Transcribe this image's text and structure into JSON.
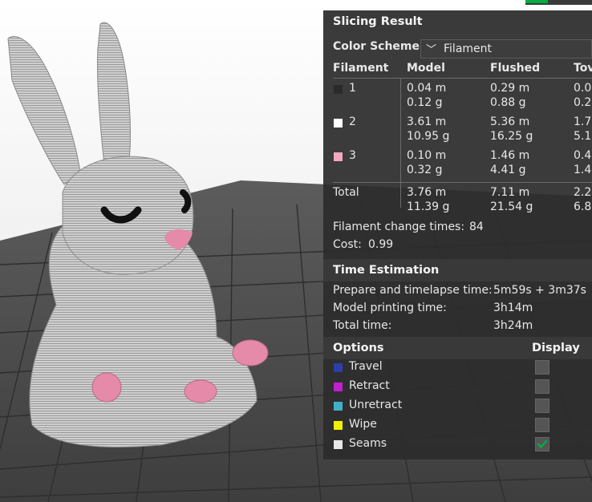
{
  "panel": {
    "title": "Slicing Result",
    "color_scheme_label": "Color Scheme",
    "color_scheme_value": "Filament",
    "table": {
      "headers": [
        "Filament",
        "Model",
        "Flushed",
        "Tov"
      ],
      "rows": [
        {
          "id": "1",
          "swatch": "#2a2a2a",
          "model_m": "0.04 m",
          "model_g": "0.12 g",
          "flushed_m": "0.29 m",
          "flushed_g": "0.88 g",
          "tower_m": "0.0",
          "tower_g": "0.2"
        },
        {
          "id": "2",
          "swatch": "#ffffff",
          "model_m": "3.61 m",
          "model_g": "10.95 g",
          "flushed_m": "5.36 m",
          "flushed_g": "16.25 g",
          "tower_m": "1.7",
          "tower_g": "5.1"
        },
        {
          "id": "3",
          "swatch": "#f4a8c0",
          "model_m": "0.10 m",
          "model_g": "0.32 g",
          "flushed_m": "1.46 m",
          "flushed_g": "4.41 g",
          "tower_m": "0.4",
          "tower_g": "1.4"
        }
      ],
      "total": {
        "label": "Total",
        "model_m": "3.76 m",
        "model_g": "11.39 g",
        "flushed_m": "7.11 m",
        "flushed_g": "21.54 g",
        "tower_m": "2.2",
        "tower_g": "6.8"
      }
    },
    "filament_change_label": "Filament change times:",
    "filament_change_value": "84",
    "cost_label": "Cost:",
    "cost_value": "0.99",
    "time_title": "Time Estimation",
    "prepare_label": "Prepare and timelapse time:",
    "prepare_value": "5m59s + 3m37s",
    "model_time_label": "Model printing time:",
    "model_time_value": "3h14m",
    "total_time_label": "Total time:",
    "total_time_value": "3h24m",
    "options_title": "Options",
    "display_title": "Display",
    "options": [
      {
        "label": "Travel",
        "color": "#2c3ea8",
        "checked": false
      },
      {
        "label": "Retract",
        "color": "#c020d0",
        "checked": false
      },
      {
        "label": "Unretract",
        "color": "#40b0c8",
        "checked": false
      },
      {
        "label": "Wipe",
        "color": "#f0f000",
        "checked": false
      },
      {
        "label": "Seams",
        "color": "#e8e8e8",
        "checked": true
      }
    ]
  },
  "colors": {
    "accent": "#00ae42",
    "bunny": "#c8c8c8",
    "pink": "#e58aa8"
  }
}
